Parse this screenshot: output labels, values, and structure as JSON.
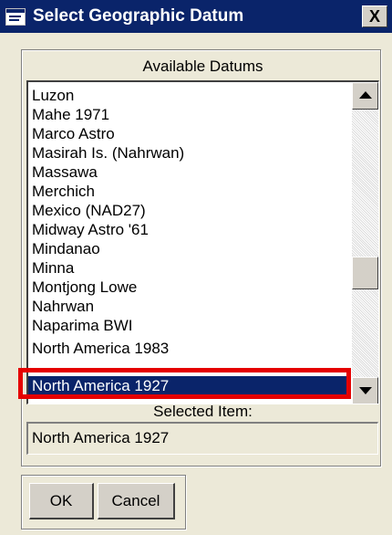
{
  "window": {
    "title": "Select Geographic Datum",
    "close_label": "X"
  },
  "available_label": "Available Datums",
  "datums": [
    "Luzon",
    "Mahe 1971",
    "Marco Astro",
    "Masirah Is. (Nahrwan)",
    "Massawa",
    "Merchich",
    "Mexico (NAD27)",
    "Midway Astro '61",
    "Mindanao",
    "Minna",
    "Montjong Lowe",
    "Nahrwan",
    "Naparima BWI",
    "North America 1983",
    "North America 1927"
  ],
  "selected_item_label": "Selected Item:",
  "selected_value": "North America 1927",
  "buttons": {
    "ok": "OK",
    "cancel": "Cancel"
  },
  "colors": {
    "titlebar": "#0a246a",
    "selection": "#0a246a",
    "highlight_frame": "#e50000",
    "dialog_face": "#ece9d8"
  }
}
